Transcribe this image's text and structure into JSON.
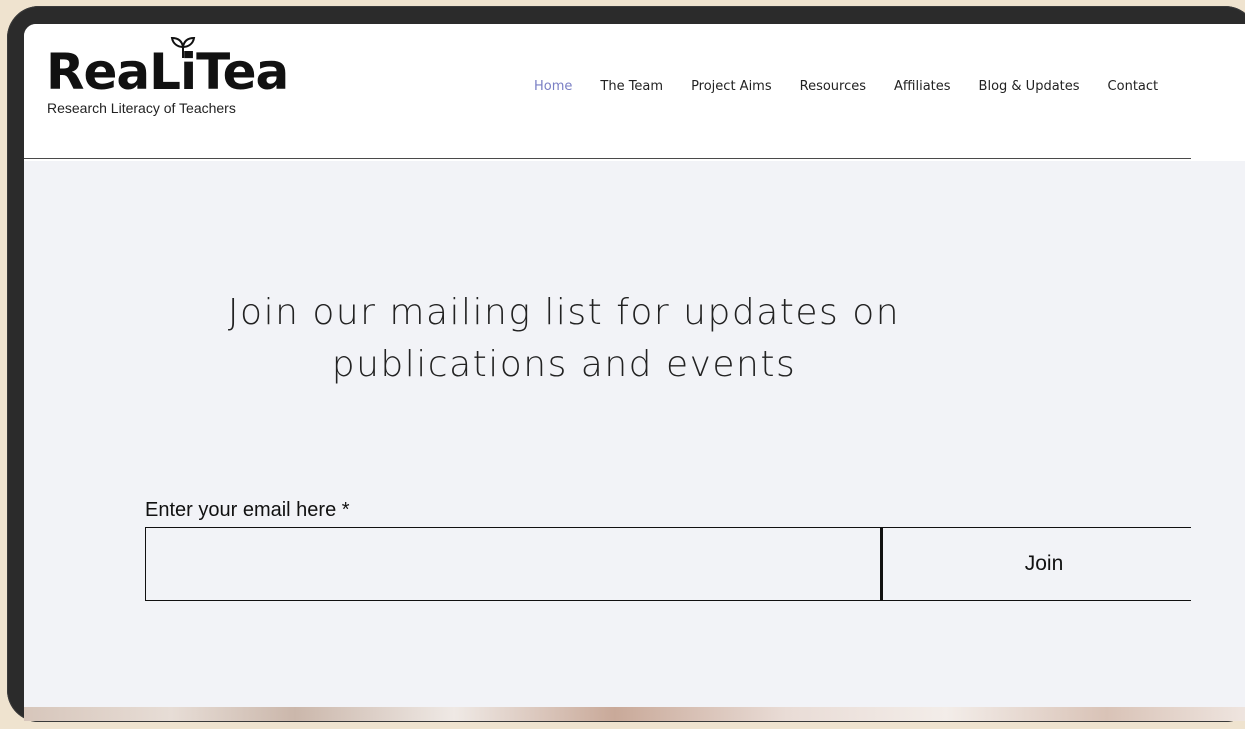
{
  "logo": {
    "wordmark": "ReaLiTea",
    "tagline": "Research Literacy of Teachers",
    "icon": "leaf-sprout-icon"
  },
  "nav": {
    "items": [
      {
        "label": "Home",
        "active": true
      },
      {
        "label": "The Team",
        "active": false
      },
      {
        "label": "Project Aims",
        "active": false
      },
      {
        "label": "Resources",
        "active": false
      },
      {
        "label": "Affiliates",
        "active": false
      },
      {
        "label": "Blog & Updates",
        "active": false
      },
      {
        "label": "Contact",
        "active": false
      }
    ],
    "active_color": "#7a7fc4"
  },
  "signup": {
    "heading_line1": "Join our mailing list for updates on",
    "heading_line2": "publications and events",
    "email_label": "Enter your email here *",
    "email_value": "",
    "join_label": "Join",
    "background_color": "#f2f3f7"
  }
}
